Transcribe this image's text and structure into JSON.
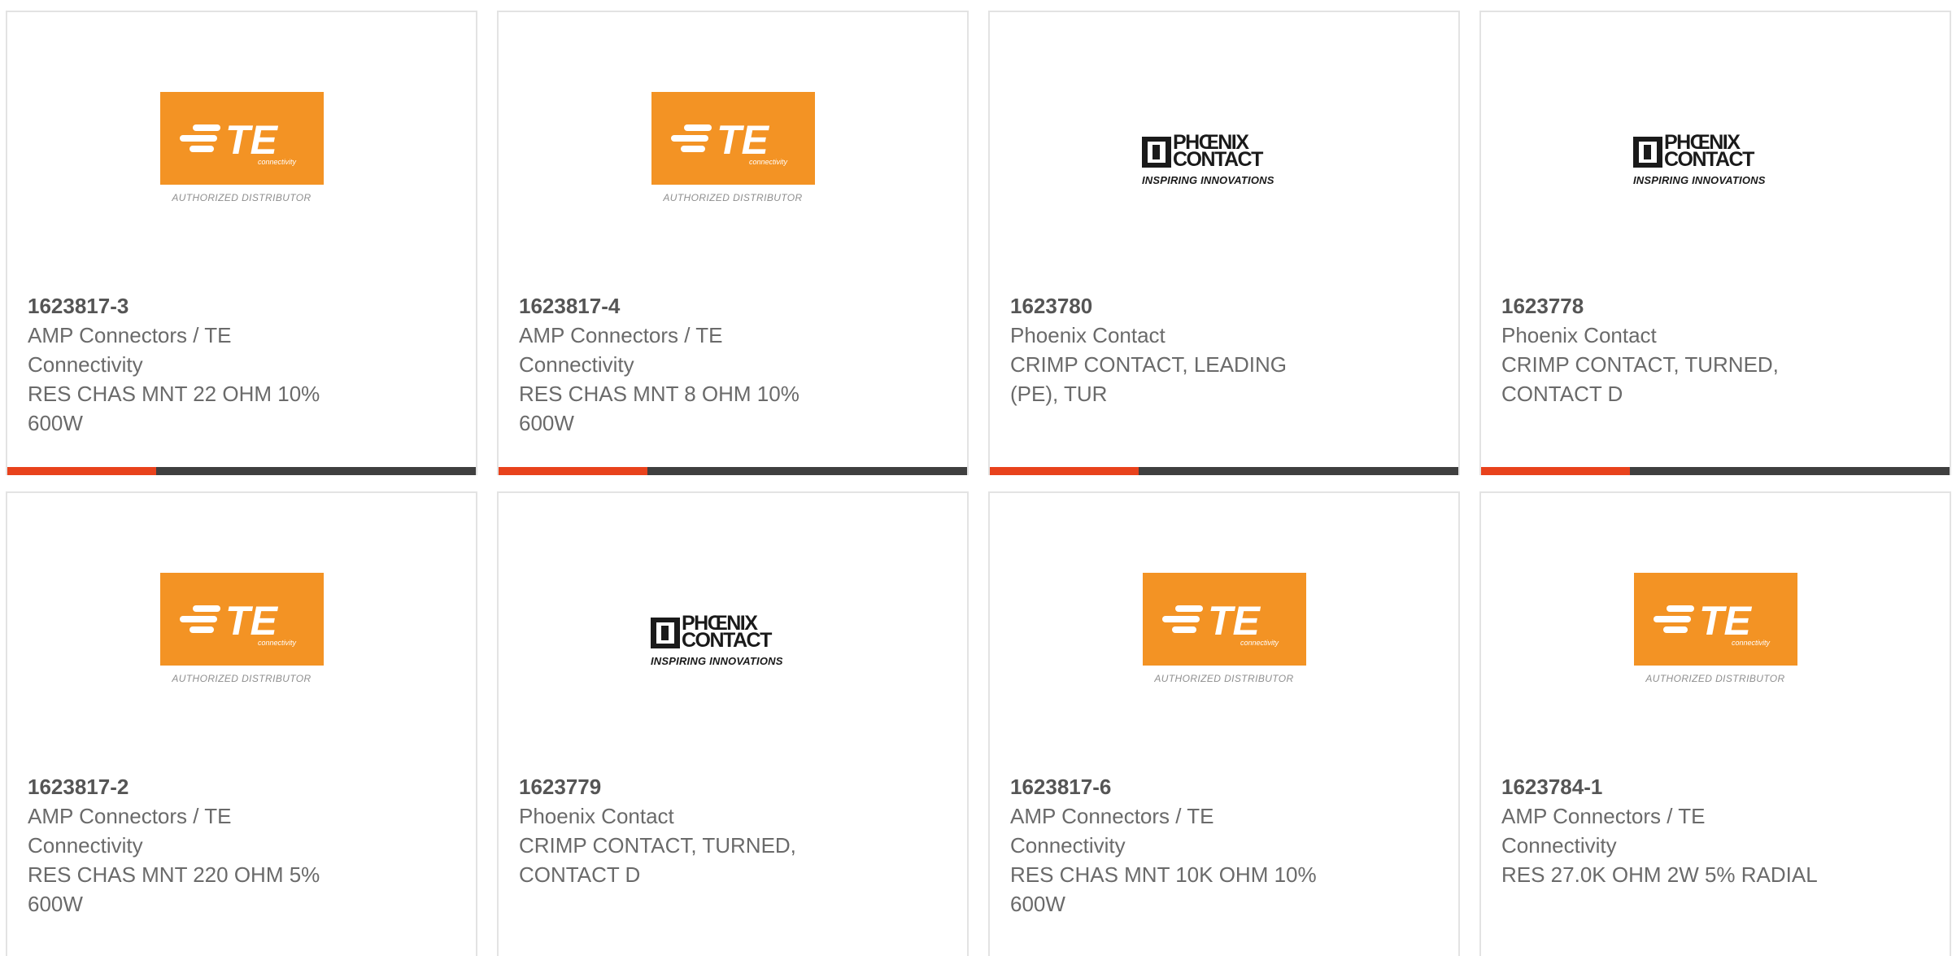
{
  "logos": {
    "te": {
      "wordmark": "TE",
      "tagline": "connectivity",
      "subtitle": "AUTHORIZED DISTRIBUTOR",
      "color": "#f39324"
    },
    "phoenix": {
      "wordmark_line1": "PHŒNIX",
      "wordmark_line2": "CONTACT",
      "tagline": "INSPIRING INNOVATIONS"
    }
  },
  "colors": {
    "accent": "#e8421c",
    "bar": "#3f3f3f",
    "border": "#e3e3e3"
  },
  "products": [
    {
      "logo": "te",
      "part_number": "1623817-3",
      "manufacturer_l1": "AMP Connectors / TE",
      "manufacturer_l2": "Connectivity",
      "desc_l1": "RES CHAS MNT 22 OHM 10%",
      "desc_l2": "600W"
    },
    {
      "logo": "te",
      "part_number": "1623817-4",
      "manufacturer_l1": "AMP Connectors / TE",
      "manufacturer_l2": "Connectivity",
      "desc_l1": "RES CHAS MNT 8 OHM 10%",
      "desc_l2": "600W"
    },
    {
      "logo": "phoenix",
      "part_number": "1623780",
      "manufacturer_l1": "Phoenix Contact",
      "manufacturer_l2": "",
      "desc_l1": "CRIMP CONTACT, LEADING",
      "desc_l2": "(PE), TUR"
    },
    {
      "logo": "phoenix",
      "part_number": "1623778",
      "manufacturer_l1": "Phoenix Contact",
      "manufacturer_l2": "",
      "desc_l1": "CRIMP CONTACT, TURNED,",
      "desc_l2": "CONTACT D"
    },
    {
      "logo": "te",
      "part_number": "1623817-2",
      "manufacturer_l1": "AMP Connectors / TE",
      "manufacturer_l2": "Connectivity",
      "desc_l1": "RES CHAS MNT 220 OHM 5%",
      "desc_l2": "600W"
    },
    {
      "logo": "phoenix",
      "part_number": "1623779",
      "manufacturer_l1": "Phoenix Contact",
      "manufacturer_l2": "",
      "desc_l1": "CRIMP CONTACT, TURNED,",
      "desc_l2": "CONTACT D"
    },
    {
      "logo": "te",
      "part_number": "1623817-6",
      "manufacturer_l1": "AMP Connectors / TE",
      "manufacturer_l2": "Connectivity",
      "desc_l1": "RES CHAS MNT 10K OHM 10%",
      "desc_l2": "600W"
    },
    {
      "logo": "te",
      "part_number": "1623784-1",
      "manufacturer_l1": "AMP Connectors / TE",
      "manufacturer_l2": "Connectivity",
      "desc_l1": "RES 27.0K OHM 2W 5% RADIAL",
      "desc_l2": ""
    }
  ]
}
